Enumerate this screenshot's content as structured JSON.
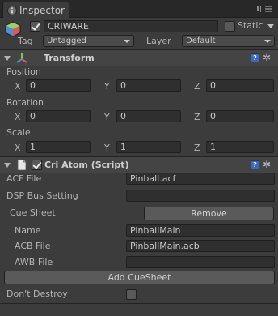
{
  "tab": {
    "title": "Inspector"
  },
  "gameobject": {
    "active": true,
    "name": "CRIWARE",
    "static_label": "Static",
    "static_checked": false,
    "tag_label": "Tag",
    "tag_value": "Untagged",
    "layer_label": "Layer",
    "layer_value": "Default"
  },
  "transform": {
    "title": "Transform",
    "position": {
      "label": "Position",
      "x": "0",
      "y": "0",
      "z": "0"
    },
    "rotation": {
      "label": "Rotation",
      "x": "0",
      "y": "0",
      "z": "0"
    },
    "scale": {
      "label": "Scale",
      "x": "1",
      "y": "1",
      "z": "1"
    },
    "axis": {
      "x": "X",
      "y": "Y",
      "z": "Z"
    }
  },
  "criatom": {
    "enabled": true,
    "title": "Cri Atom (Script)",
    "acf_label": "ACF File",
    "acf_value": "Pinball.acf",
    "dsp_label": "DSP Bus Setting",
    "dsp_value": "",
    "cuesheet_label": "Cue Sheet",
    "remove_label": "Remove",
    "name_label": "Name",
    "name_value": "PinballMain",
    "acb_label": "ACB File",
    "acb_value": "PinballMain.acb",
    "awb_label": "AWB File",
    "awb_value": "",
    "add_label": "Add CueSheet",
    "dontdestroy_label": "Don't Destroy",
    "dontdestroy_checked": false
  }
}
